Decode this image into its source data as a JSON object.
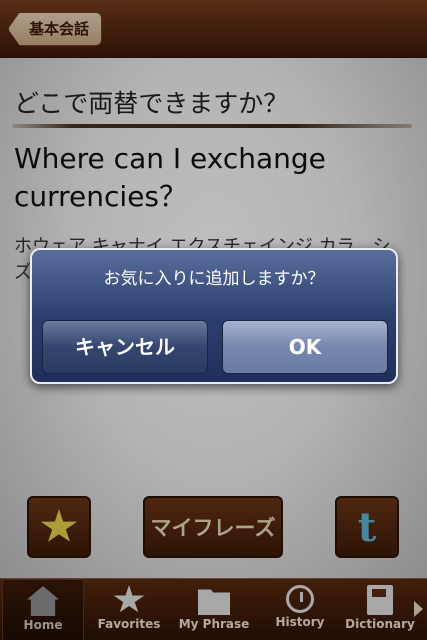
{
  "navbar": {
    "back_label": "基本会話"
  },
  "phrase": {
    "japanese": "どこで両替できますか？",
    "english": "Where can I exchange currencies？",
    "reading": "ホウェア キャナイ エクスチェインジ カラ…シズ？"
  },
  "actions": {
    "myphrase_label": "マイフレーズ",
    "twitter_glyph": "t"
  },
  "tabs": [
    {
      "label": "Home",
      "icon": "home-icon"
    },
    {
      "label": "Favorites",
      "icon": "star-icon"
    },
    {
      "label": "My Phrase",
      "icon": "folder-icon"
    },
    {
      "label": "History",
      "icon": "clock-icon"
    },
    {
      "label": "Dictionary",
      "icon": "book-icon"
    }
  ],
  "alert": {
    "message": "お気に入りに追加しますか？",
    "cancel_label": "キャンセル",
    "ok_label": "OK"
  }
}
